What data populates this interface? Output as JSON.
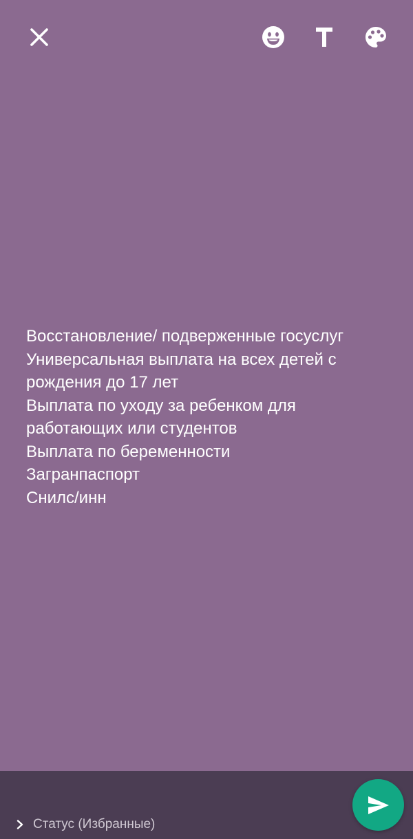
{
  "colors": {
    "background": "#8b6a90",
    "bottom_bar": "#4b3d53",
    "accent": "#12a884"
  },
  "toolbar": {
    "icons": [
      "close-icon",
      "emoji-icon",
      "text-icon",
      "palette-icon"
    ]
  },
  "status_text": {
    "lines": [
      "Восстановление/ подверженные госуслуг",
      "Универсальная выплата на всех детей с",
      "рождения до 17 лет",
      "Выплата по уходу за ребенком для",
      "работающих или студентов",
      "Выплата по беременности",
      "Загранпаспорт",
      "Снилс/инн"
    ]
  },
  "bottom": {
    "audience_label": "Статус (Избранные)",
    "send_icon": "send-icon"
  }
}
